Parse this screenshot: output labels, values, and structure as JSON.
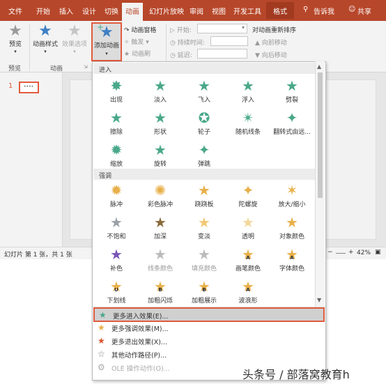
{
  "tabs": [
    "文件",
    "开始",
    "插入",
    "设计",
    "切换",
    "动画",
    "幻灯片放映",
    "审阅",
    "视图",
    "开发工具",
    "格式"
  ],
  "tell_me": "告诉我",
  "share": "共享",
  "ribbon": {
    "preview": "预览",
    "animation_styles": "动画样式",
    "effect_options": "效果选项",
    "add_animation": "添加动画",
    "add_animation_line1": "添加动画",
    "animation_pane": "动画窗格",
    "trigger": "触发",
    "animation_painter": "动画刷",
    "start": "开始:",
    "duration": "持续时间:",
    "delay": "延迟:",
    "reorder": "对动画重新排序",
    "move_earlier": "向前移动",
    "move_later": "向后移动",
    "group_preview": "预览",
    "group_animation": "动画"
  },
  "thumb_number": "1",
  "status": {
    "slide_info": "幻灯片 第 1 张，共 1 张",
    "zoom": "42%"
  },
  "gallery": {
    "sections": {
      "entrance": "进入",
      "emphasis": "强调"
    },
    "entrance": [
      "出现",
      "淡入",
      "飞入",
      "浮入",
      "劈裂",
      "擦除",
      "形状",
      "轮子",
      "随机线条",
      "翻转式由远...",
      "缩放",
      "旋转",
      "弹跳"
    ],
    "emphasis": [
      "脉冲",
      "彩色脉冲",
      "跷跷板",
      "陀螺旋",
      "放大/缩小",
      "不饱和",
      "加深",
      "变淡",
      "透明",
      "对象颜色",
      "补色",
      "线条颜色",
      "填充颜色",
      "画笔颜色",
      "字体颜色",
      "下划线",
      "加粗闪烁",
      "加粗展示",
      "波浪形"
    ],
    "badges": {
      "underline": "U",
      "boldflash": "B",
      "boldreveal": "B",
      "wave": "A",
      "brush": "A",
      "font": "A"
    }
  },
  "menu": [
    {
      "label": "更多进入效果(E)...",
      "icon": "green-star-icon"
    },
    {
      "label": "更多强调效果(M)...",
      "icon": "gold-star-icon"
    },
    {
      "label": "更多退出效果(X)...",
      "icon": "red-star-icon"
    },
    {
      "label": "其他动作路径(P)...",
      "icon": "outline-star-icon"
    },
    {
      "label": "OLE 操作动作(O)...",
      "icon": "ole-icon"
    }
  ],
  "watermark": "头条号 / 部落窝教育h",
  "colors": {
    "accent": "#b7472a",
    "entrance": "#4aa88a",
    "emphasis": "#e8b04a",
    "exit": "#d9542c",
    "highlight_border": "#e25a3d"
  }
}
